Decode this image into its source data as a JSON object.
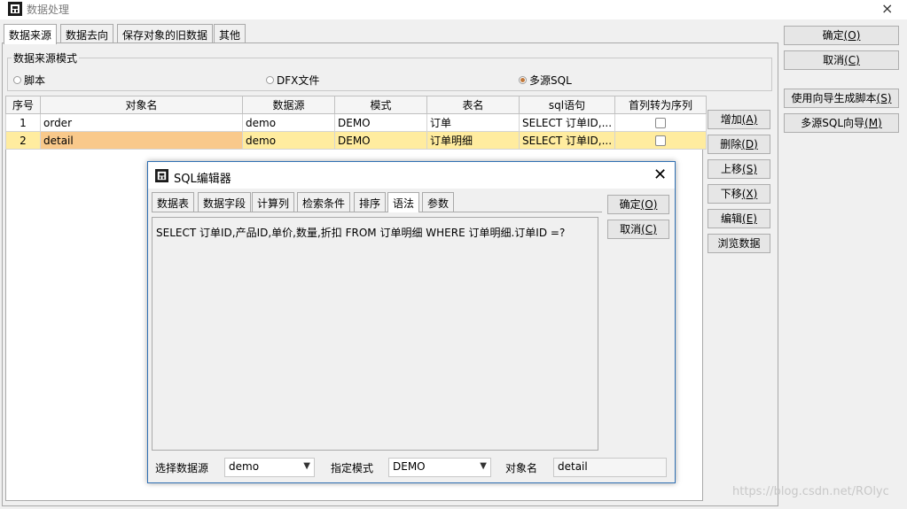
{
  "window": {
    "title": "数据处理",
    "close_glyph": "×",
    "tabs": [
      "数据来源",
      "数据去向",
      "保存对象的旧数据",
      "其他"
    ]
  },
  "source_mode": {
    "legend": "数据来源模式",
    "options": [
      {
        "label": "脚本",
        "checked": false
      },
      {
        "label": "DFX文件",
        "checked": false
      },
      {
        "label": "多源SQL",
        "checked": true
      }
    ]
  },
  "table": {
    "columns": [
      "序号",
      "对象名",
      "数据源",
      "模式",
      "表名",
      "sql语句",
      "首列转为序列"
    ],
    "rows": [
      {
        "seq": "1",
        "name": "order",
        "source": "demo",
        "schema": "DEMO",
        "table": "订单",
        "sql": "SELECT 订单ID,...",
        "first_col_seq": false,
        "selected": false
      },
      {
        "seq": "2",
        "name": "detail",
        "source": "demo",
        "schema": "DEMO",
        "table": "订单明细",
        "sql": "SELECT 订单ID,...",
        "first_col_seq": false,
        "selected": true
      }
    ]
  },
  "row_buttons": {
    "add": "增加",
    "add_key": "(A)",
    "delete": "删除",
    "delete_key": "(D)",
    "up": "上移",
    "up_key": "(S)",
    "down": "下移",
    "down_key": "(X)",
    "edit": "编辑",
    "edit_key": "(E)",
    "browse": "浏览数据"
  },
  "right_buttons": {
    "ok": "确定",
    "ok_key": "(O)",
    "cancel": "取消",
    "cancel_key": "(C)",
    "wizard_script": "使用向导生成脚本",
    "wizard_script_key": "(S)",
    "multi_sql_wizard": "多源SQL向导",
    "multi_sql_wizard_key": "(M)"
  },
  "sql_editor": {
    "title": "SQL编辑器",
    "close_glyph": "✕",
    "tabs": [
      "数据表",
      "数据字段",
      "计算列",
      "检索条件",
      "排序",
      "语法",
      "参数"
    ],
    "active_tab": "语法",
    "sql_text": "SELECT 订单ID,产品ID,单价,数量,折扣 FROM 订单明细 WHERE  订单明细.订单ID =?",
    "ok": "确定",
    "ok_key": "(O)",
    "cancel": "取消",
    "cancel_key": "(C)",
    "datasource_label": "选择数据源",
    "datasource_value": "demo",
    "schema_label": "指定模式",
    "schema_value": "DEMO",
    "object_label": "对象名",
    "object_value": "detail"
  },
  "watermark": "https://blog.csdn.net/ROlyc",
  "colors": {
    "selected_row": "#ffec9f",
    "selected_cell": "#f9c98b",
    "dialog_border": "#2f6fb3",
    "radio_accent": "#c1783a"
  }
}
